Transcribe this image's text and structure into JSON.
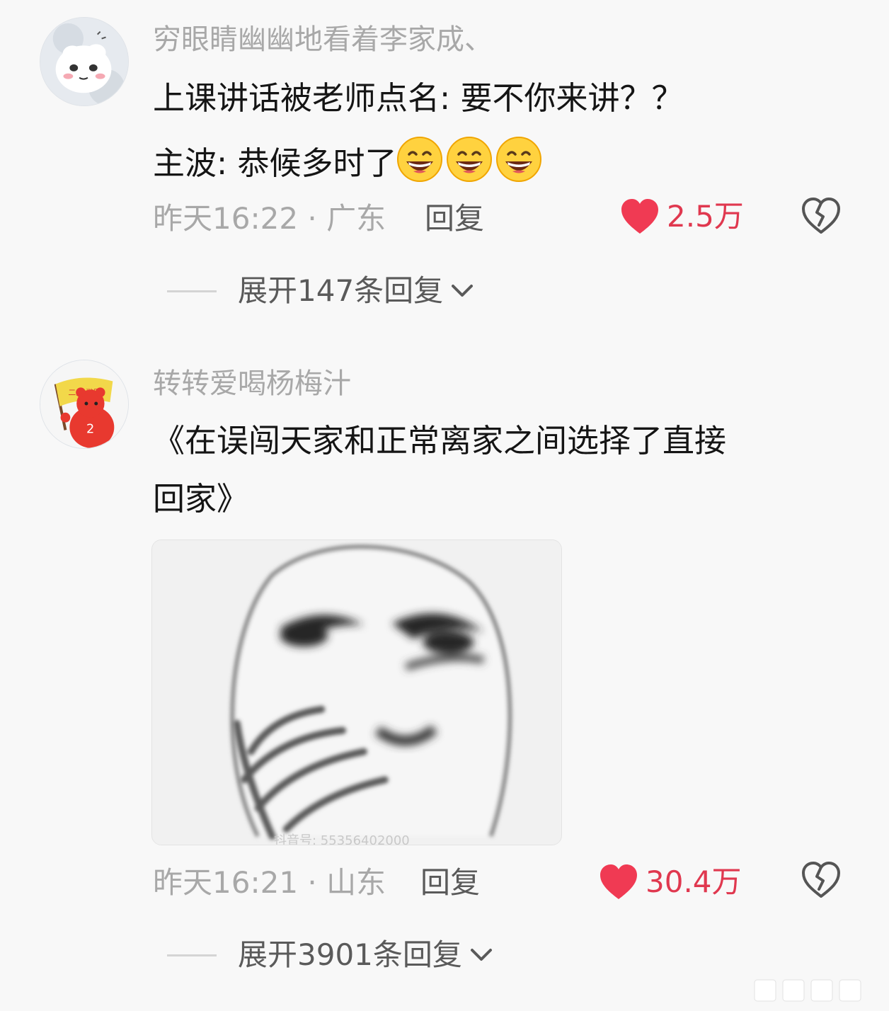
{
  "comments": [
    {
      "username": "穷眼睛幽幽地看着李家成、",
      "lines": [
        "上课讲话被老师点名: 要不你来讲？？",
        "主波: 恭候多时了"
      ],
      "emoji_count": 3,
      "emoji_icon": "grinning-face-icon",
      "time_location": "昨天16:22 · 广东",
      "reply_label": "回复",
      "likes": "2.5万",
      "expand_label": "展开147条回复"
    },
    {
      "username": "转转爱喝杨梅汁",
      "lines": [
        "《在误闯天家和正常离家之间选择了直接",
        "回家》"
      ],
      "image_watermark": "抖音号: 55356402000",
      "time_location": "昨天16:21 · 山东",
      "reply_label": "回复",
      "likes": "30.4万",
      "expand_label": "展开3901条回复"
    }
  ],
  "colors": {
    "background": "#f8f8f8",
    "like_red": "#e0384f",
    "meta_gray": "#a8a8a8",
    "text_dark": "#151515"
  }
}
